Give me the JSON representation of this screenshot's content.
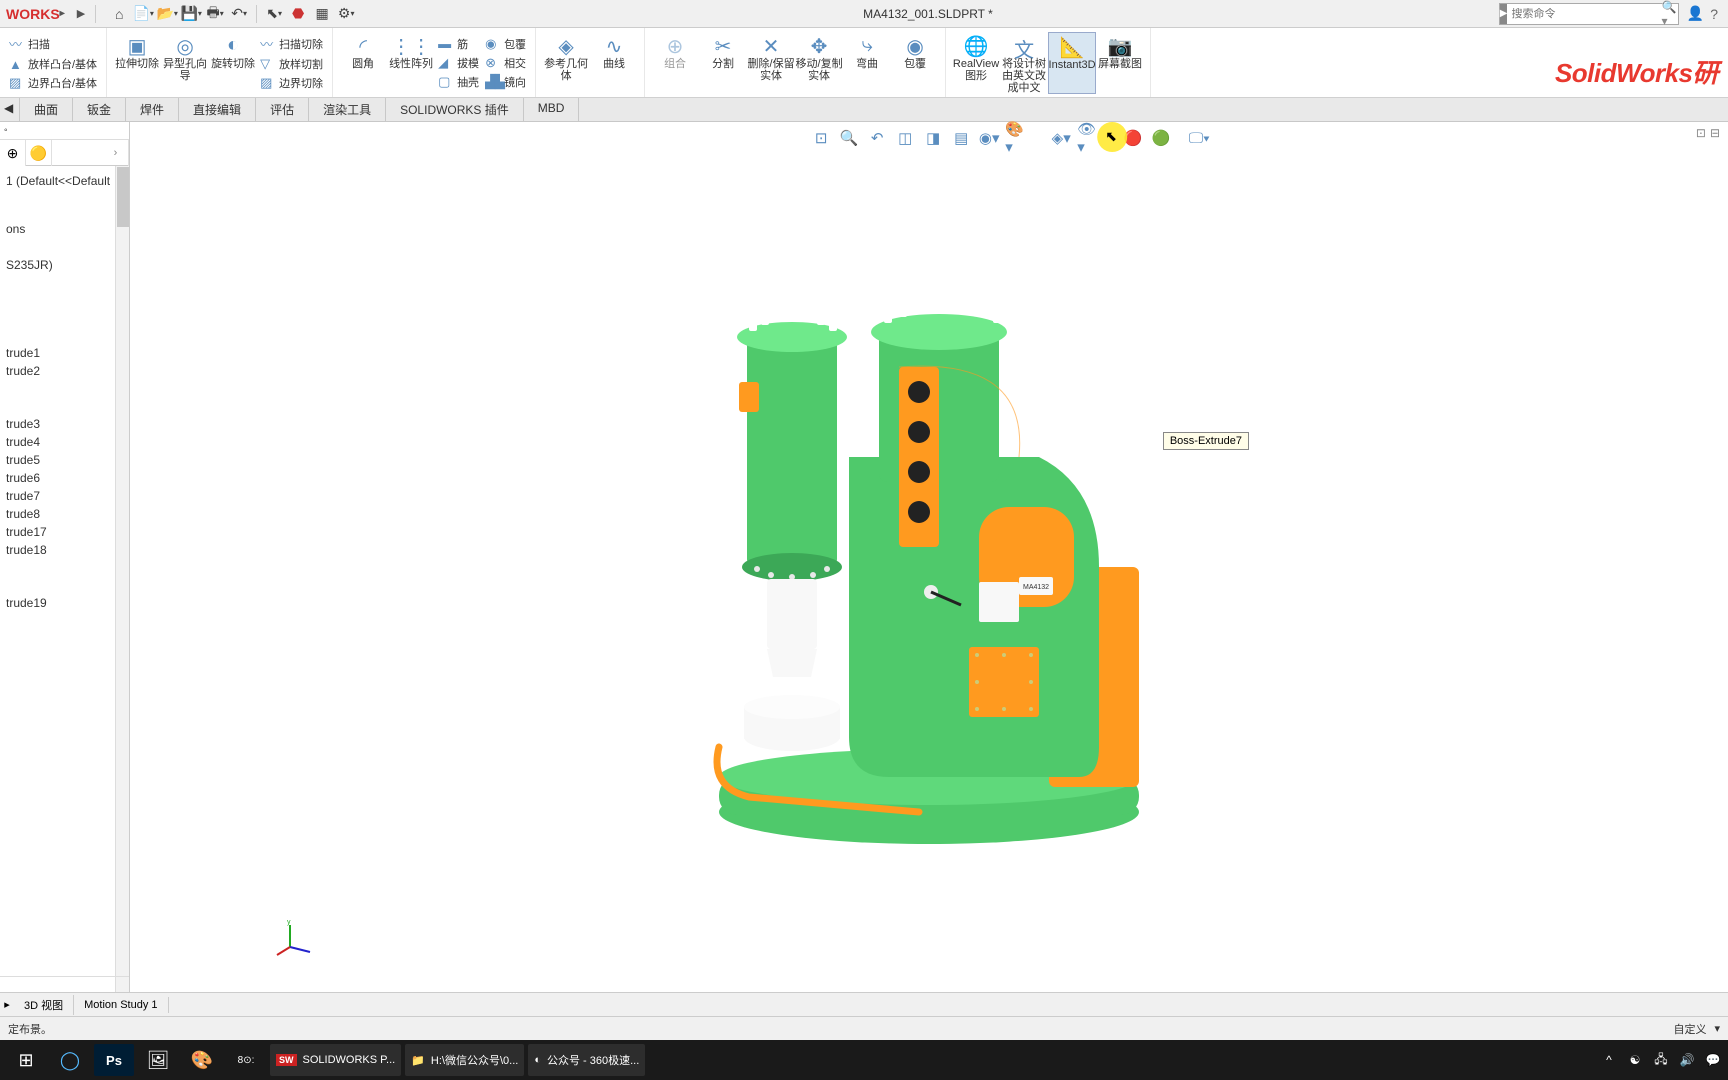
{
  "app": {
    "name": "WORKS",
    "document_title": "MA4132_001.SLDPRT *"
  },
  "search": {
    "placeholder": "搜索命令"
  },
  "quickAccess": [
    "home",
    "new",
    "open",
    "save",
    "print",
    "undo",
    "select",
    "rebuild",
    "options",
    "settings"
  ],
  "ribbon": {
    "groups1": {
      "scan": "扫描",
      "boss_base": "放样凸台/基体",
      "boundary_boss": "边界凸台/基体",
      "extrude_cut": "拉伸切除",
      "hole_wizard": "异型孔向导",
      "revolve_cut": "旋转切除",
      "sweep_cut": "扫描切除",
      "loft_cut": "放样切割",
      "boundary_cut": "边界切除",
      "fillet": "圆角",
      "linear_pattern": "线性阵列",
      "rib": "筋",
      "draft": "拔模",
      "shell": "抽壳",
      "wrap": "包覆",
      "intersect": "相交",
      "mirror": "镜向",
      "ref_geom": "参考几何体",
      "curves": "曲线",
      "combine": "组合",
      "split": "分割",
      "delete_keep": "删除/保留实体",
      "move_copy": "移动/复制实体",
      "flex": "弯曲",
      "wrap2": "包覆",
      "realview": "RealView 图形",
      "tree_cn": "将设计树由英文改成中文",
      "instant3d": "Instant3D",
      "screenshot": "屏幕截图"
    }
  },
  "tabs": [
    "曲面",
    "钣金",
    "焊件",
    "直接编辑",
    "评估",
    "渲染工具",
    "SOLIDWORKS 插件",
    "MBD"
  ],
  "tree": {
    "root": "1 (Default<<Default",
    "items": [
      "ons",
      "S235JR)",
      "",
      "trude1",
      "trude2",
      "",
      "trude3",
      "trude4",
      "trude5",
      "trude6",
      "trude7",
      "trude8",
      "trude17",
      "trude18",
      "",
      "trude19"
    ]
  },
  "tooltip": "Boss-Extrude7",
  "plate_label": "MA4132",
  "brand": "SolidWorks研",
  "bottomTabs": [
    "3D 视图",
    "Motion Study 1"
  ],
  "status": {
    "left": "定布景。",
    "right": "自定义"
  },
  "taskbar": {
    "apps": [
      {
        "icon": "◉",
        "label": ""
      },
      {
        "icon": "Ps",
        "label": ""
      },
      {
        "icon": "🖼",
        "label": ""
      },
      {
        "icon": "🎨",
        "label": ""
      },
      {
        "icon": "⬛",
        "label": ""
      },
      {
        "icon": "SW",
        "label": "SOLIDWORKS P..."
      },
      {
        "icon": "📁",
        "label": "H:\\微信公众号\\0..."
      },
      {
        "icon": "◐",
        "label": "公众号 - 360极速..."
      }
    ]
  }
}
